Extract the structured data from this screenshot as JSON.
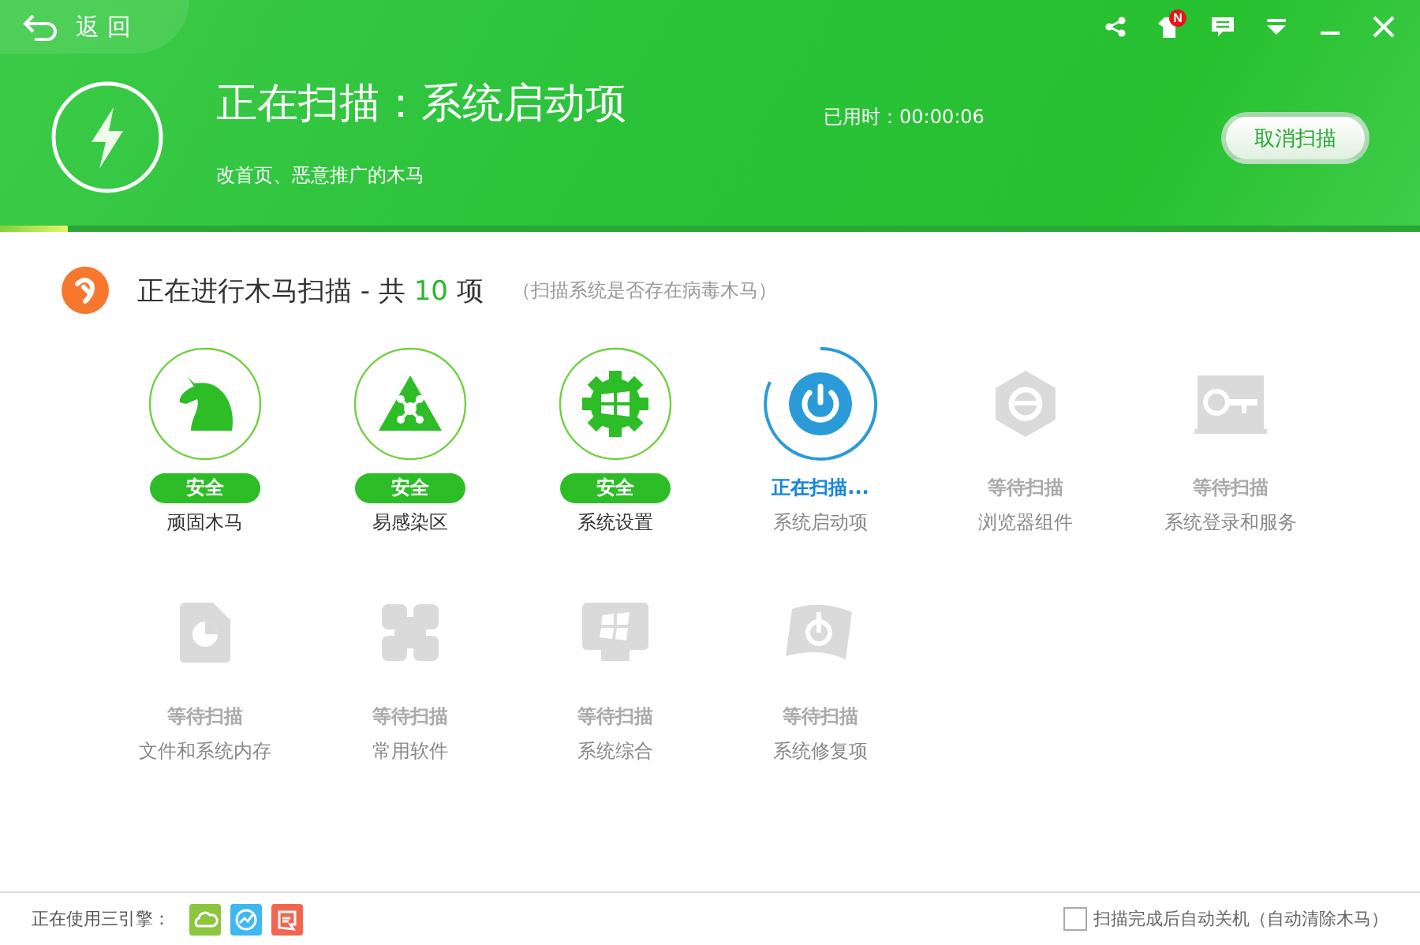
{
  "back_button": {
    "label": "返 回"
  },
  "title_badge": "N",
  "scan": {
    "title": "正在扫描：系统启动项",
    "subtitle": "改首页、恶意推广的木马",
    "elapsed": "已用时：00:00:06",
    "cancel": "取消扫描",
    "progress": {
      "level": 0.048
    }
  },
  "section": {
    "heading_prefix": "正在进行木马扫描 - 共",
    "count": "10",
    "heading_suffix": "项",
    "note": "（扫描系统是否存在病毒木马）"
  },
  "items": [
    {
      "kind": "safe",
      "status": "安全",
      "name": "顽固木马"
    },
    {
      "kind": "safe",
      "status": "安全",
      "name": "易感染区"
    },
    {
      "kind": "safe",
      "status": "安全",
      "name": "系统设置"
    },
    {
      "kind": "scanning",
      "status": "正在扫描...",
      "name": "系统启动项"
    },
    {
      "kind": "waiting",
      "status": "等待扫描",
      "name": "浏览器组件"
    },
    {
      "kind": "waiting",
      "status": "等待扫描",
      "name": "系统登录和服务"
    },
    {
      "kind": "waiting",
      "status": "等待扫描",
      "name": "文件和系统内存"
    },
    {
      "kind": "waiting",
      "status": "等待扫描",
      "name": "常用软件"
    },
    {
      "kind": "waiting",
      "status": "等待扫描",
      "name": "系统综合"
    },
    {
      "kind": "waiting",
      "status": "等待扫描",
      "name": "系统修复项"
    }
  ],
  "footer": {
    "engines_label": "正在使用三引擎：",
    "engines": [
      {
        "color": "#8cc63f"
      },
      {
        "color": "#3fb8f0"
      },
      {
        "color": "#f26650"
      }
    ],
    "auto_shutdown": {
      "label": "扫描完成后自动关机（自动清除木马）",
      "checked": false
    }
  }
}
